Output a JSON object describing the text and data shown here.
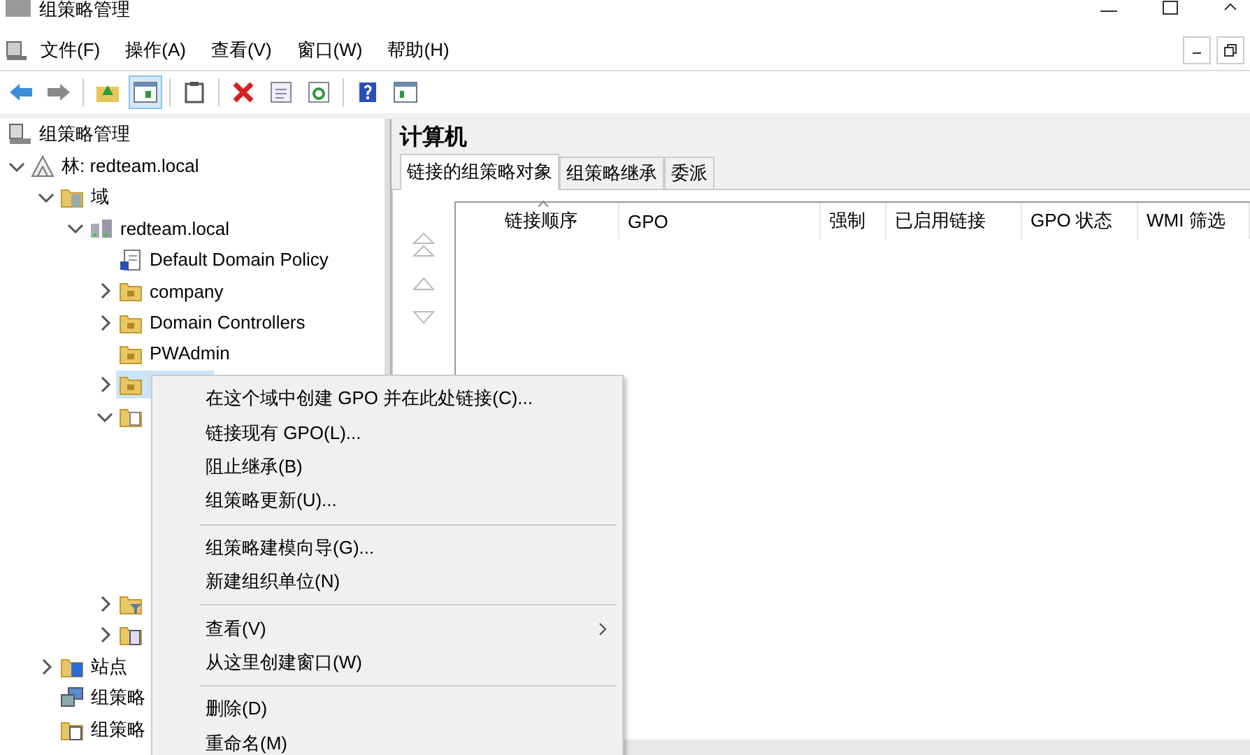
{
  "window": {
    "title": "组策略管理"
  },
  "menu_bar": [
    "文件(F)",
    "操作(A)",
    "查看(V)",
    "窗口(W)",
    "帮助(H)"
  ],
  "toolbar": [
    {
      "kind": "back",
      "selected": false
    },
    {
      "kind": "forward",
      "selected": false
    },
    {
      "kind": "sep"
    },
    {
      "kind": "up",
      "selected": false
    },
    {
      "kind": "tree",
      "selected": true
    },
    {
      "kind": "sep"
    },
    {
      "kind": "clipboard",
      "selected": false
    },
    {
      "kind": "sep"
    },
    {
      "kind": "delete",
      "selected": false
    },
    {
      "kind": "properties",
      "selected": false
    },
    {
      "kind": "refresh",
      "selected": false
    },
    {
      "kind": "sep"
    },
    {
      "kind": "help",
      "selected": false
    },
    {
      "kind": "pane",
      "selected": false
    }
  ],
  "tree": [
    {
      "label": "组策略管理",
      "kind": "console",
      "selected": false,
      "children": [
        {
          "label": "林: redteam.local",
          "kind": "forest",
          "selected": false,
          "expanded": true,
          "children": [
            {
              "label": "域",
              "kind": "domains",
              "selected": false,
              "expanded": true,
              "children": [
                {
                  "label": "redteam.local",
                  "kind": "domain",
                  "selected": false,
                  "expanded": true,
                  "children": [
                    {
                      "label": "Default Domain Policy",
                      "kind": "gpo",
                      "selected": false
                    },
                    {
                      "label": "company",
                      "kind": "ou",
                      "selected": false,
                      "expanded": false
                    },
                    {
                      "label": "Domain Controllers",
                      "kind": "ou",
                      "selected": false,
                      "expanded": false
                    },
                    {
                      "label": "PWAdmin",
                      "kind": "ou",
                      "selected": false
                    },
                    {
                      "kind": "ou",
                      "selected": true,
                      "expanded": false
                    },
                    {
                      "kind": "gpos",
                      "selected": false,
                      "expanded": true
                    },
                    {
                      "kind": "filter",
                      "selected": false,
                      "expanded": false
                    },
                    {
                      "kind": "starter",
                      "selected": false,
                      "expanded": false
                    }
                  ]
                }
              ]
            },
            {
              "label": "站点",
              "kind": "sites",
              "selected": false,
              "expanded": false
            },
            {
              "label": "组策略",
              "kind": "modeling",
              "selected": false
            },
            {
              "label": "组策略",
              "kind": "results",
              "selected": false
            }
          ]
        }
      ]
    }
  ],
  "details": {
    "title": "计算机",
    "tabs": [
      {
        "label": "链接的组策略对象",
        "selected": true
      },
      {
        "label": "组策略继承",
        "selected": false
      },
      {
        "label": "委派",
        "selected": false
      }
    ],
    "columns": [
      "链接顺序",
      "GPO",
      "强制",
      "已启用链接",
      "GPO 状态",
      "WMI 筛选"
    ]
  },
  "context_menu": [
    [
      {
        "label": "在这个域中创建 GPO 并在此处链接(C)..."
      },
      {
        "label": "链接现有 GPO(L)..."
      },
      {
        "label": "阻止继承(B)"
      },
      {
        "label": "组策略更新(U)..."
      }
    ],
    [
      {
        "label": "组策略建模向导(G)..."
      },
      {
        "label": "新建组织单位(N)"
      }
    ],
    [
      {
        "label": "查看(V)",
        "submenu": true
      },
      {
        "label": "从这里创建窗口(W)"
      }
    ],
    [
      {
        "label": "删除(D)"
      },
      {
        "label": "重命名(M)"
      }
    ]
  ]
}
